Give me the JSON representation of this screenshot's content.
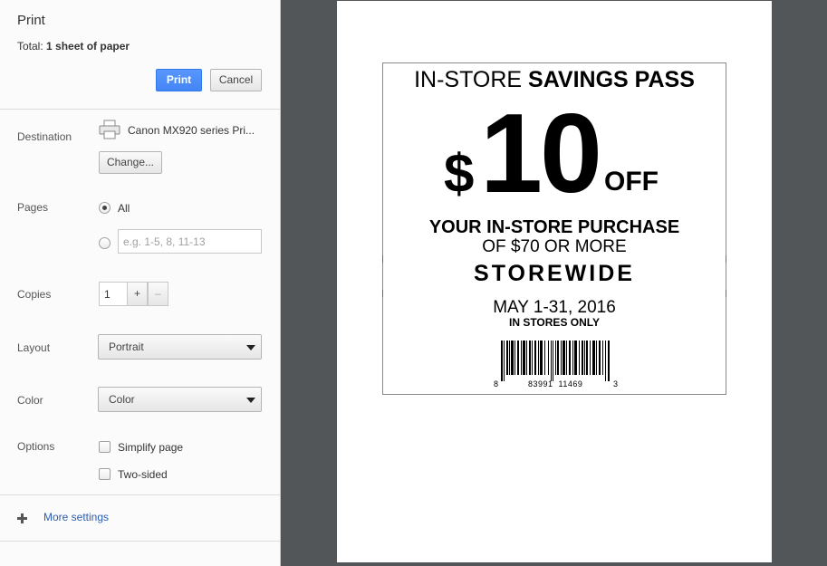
{
  "header": {
    "title": "Print",
    "total_prefix": "Total: ",
    "total_value": "1 sheet of paper",
    "print_label": "Print",
    "cancel_label": "Cancel"
  },
  "destination": {
    "label": "Destination",
    "printer_name": "Canon MX920 series Pri...",
    "change_label": "Change..."
  },
  "pages": {
    "label": "Pages",
    "all_label": "All",
    "custom_placeholder": "e.g. 1-5, 8, 11-13",
    "selected": "All"
  },
  "copies": {
    "label": "Copies",
    "value": "1",
    "increment_label": "+",
    "decrement_label": "–"
  },
  "layout": {
    "label": "Layout",
    "selected": "Portrait"
  },
  "color": {
    "label": "Color",
    "selected": "Color"
  },
  "options": {
    "label": "Options",
    "simplify_label": "Simplify page",
    "two_sided_label": "Two-sided"
  },
  "more_settings": {
    "label": "More settings"
  },
  "preview": {
    "coupon": {
      "title_prefix": "IN-STORE ",
      "title_bold": "SAVINGS PASS",
      "dollar_sign": "$",
      "amount": "10",
      "off": "OFF",
      "line1": "YOUR IN-STORE PURCHASE",
      "line2": "OF $70 OR MORE",
      "storewide": "STOREWIDE",
      "date": "MAY 1-31, 2016",
      "in_stores_only": "IN STORES ONLY",
      "barcode_left": "8",
      "barcode_middle": "83991 11469",
      "barcode_right": "3"
    }
  },
  "colors": {
    "accent": "#4285f4",
    "link": "#2a5db0",
    "preview_background": "#525659"
  }
}
